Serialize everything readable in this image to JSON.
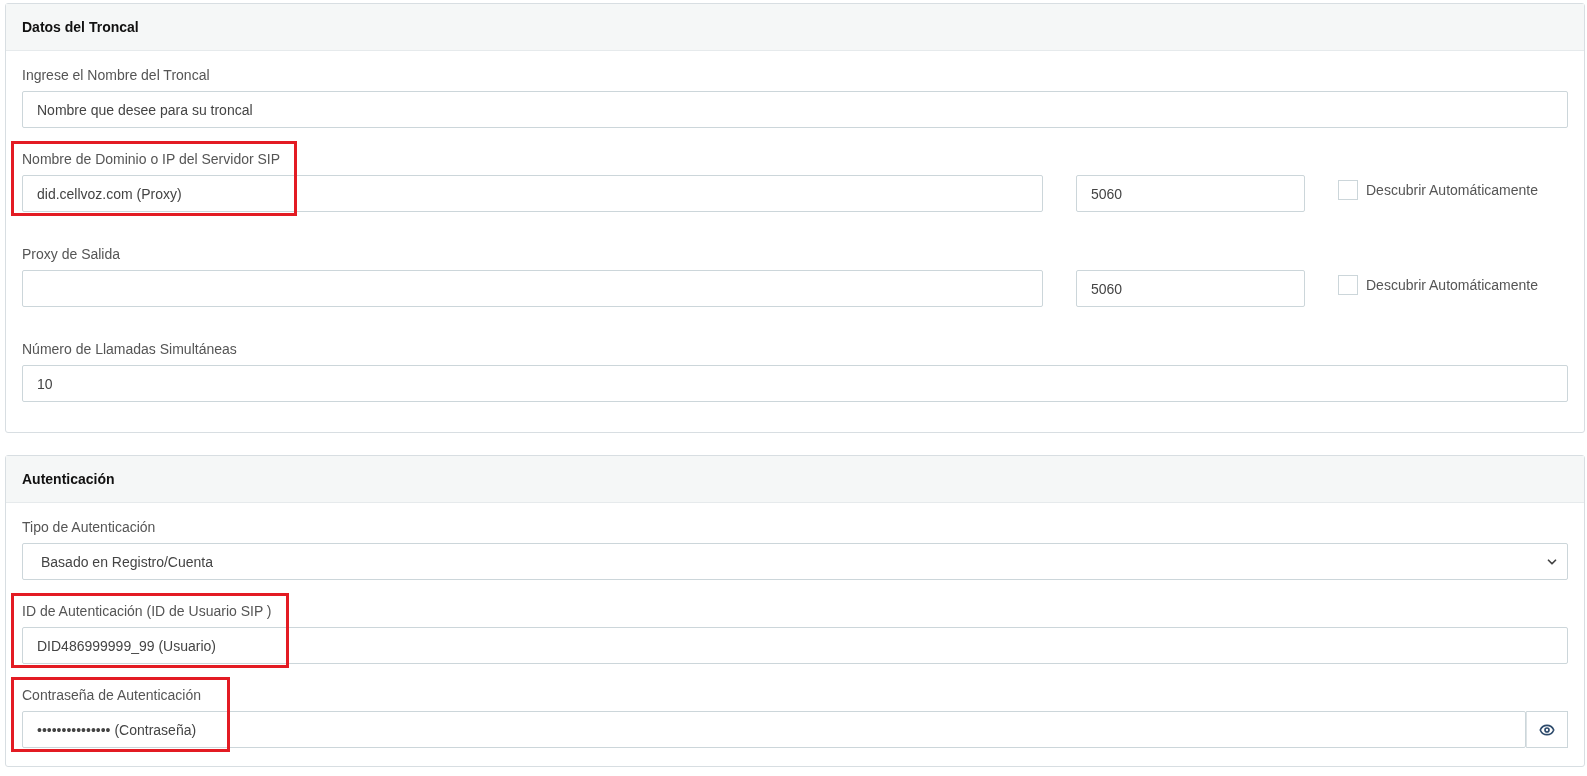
{
  "sections": [
    {
      "title": "Datos del Troncal",
      "fields": [
        {
          "kind": "text",
          "label": "Ingrese el Nombre del Troncal",
          "value": "Nombre que desee para su troncal",
          "highlighted": false
        },
        {
          "kind": "host",
          "label": "Nombre de Dominio o IP del Servidor SIP",
          "value": "did.cellvoz.com (Proxy)",
          "port": "5060",
          "auto_label": "Descubrir Automáticamente",
          "checked": false,
          "highlighted": true
        },
        {
          "kind": "host",
          "label": "Proxy de Salida",
          "port": "5060",
          "auto_label": "Descubrir Automáticamente",
          "checked": false,
          "highlighted": false
        },
        {
          "kind": "text",
          "label": "Número de Llamadas Simultáneas",
          "value": "10",
          "highlighted": false
        }
      ]
    },
    {
      "title": "Autenticación",
      "fields": [
        {
          "kind": "select",
          "label": "Tipo de Autenticación",
          "value": "Basado en Registro/Cuenta",
          "highlighted": false
        },
        {
          "kind": "text",
          "label": "ID de Autenticación (ID de Usuario SIP )",
          "value": "DID486999999_99 (Usuario)",
          "highlighted": true
        },
        {
          "kind": "password",
          "label": "Contraseña de Autenticación",
          "value": "••••••••••••••• (Contraseña)",
          "highlighted": true
        }
      ]
    }
  ]
}
